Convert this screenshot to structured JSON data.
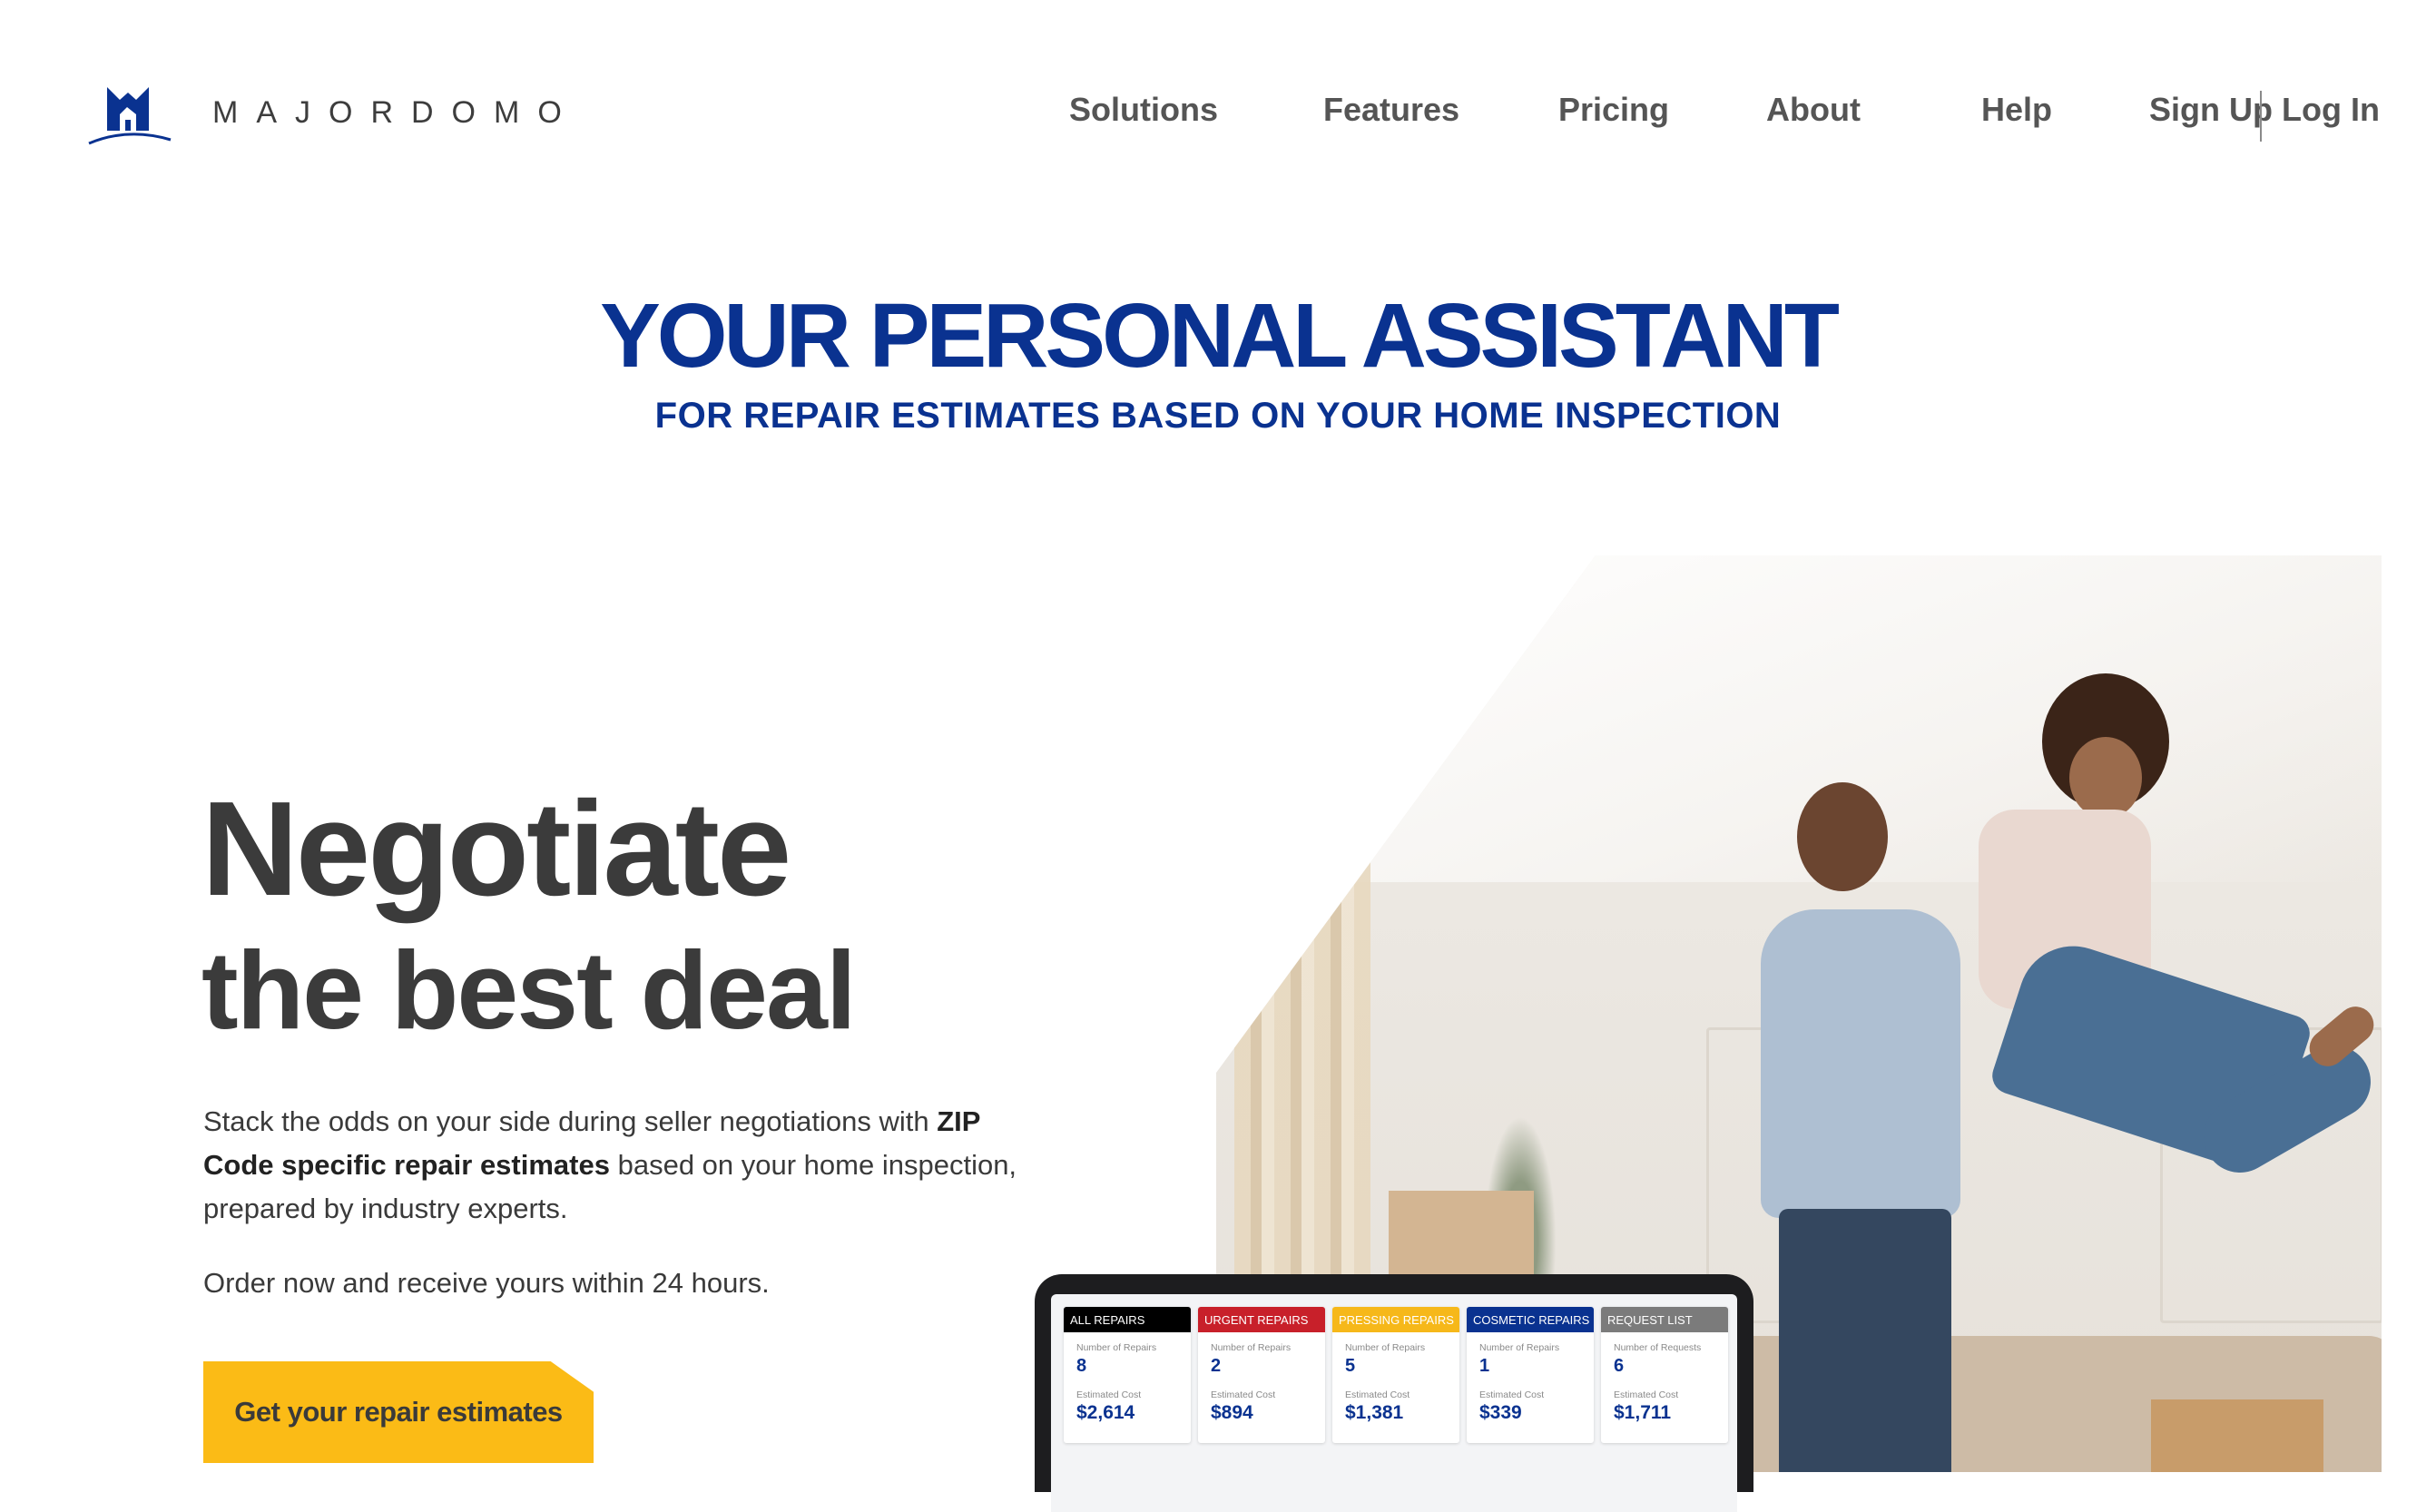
{
  "brand": {
    "name": "MAJORDOMO",
    "color": "#0a3290",
    "logo_icon": "house-logo-icon"
  },
  "nav": {
    "items": [
      "Solutions",
      "Features",
      "Pricing",
      "About",
      "Help",
      "Sign Up",
      "Log In"
    ]
  },
  "hero": {
    "title": "YOUR PERSONAL ASSISTANT",
    "subtitle": "FOR REPAIR ESTIMATES BASED ON YOUR HOME INSPECTION"
  },
  "main": {
    "headline_1": "Negotiate",
    "headline_2": "the best deal",
    "p1_a": "Stack the odds on your side during seller negotiations with ",
    "p1_bold": "ZIP Code specific repair estimates",
    "p1_c": " based on your home inspection, prepared by industry experts.",
    "p2": "Order now and receive yours within 24 hours.",
    "cta_label": "Get your repair estimates",
    "cta_color": "#fbbb16"
  },
  "photo": {
    "alt": "couple-celebrating-photo"
  },
  "dashboard": {
    "cards": [
      {
        "title": "ALL REPAIRS",
        "color": "#000000",
        "count_label": "Number of Repairs",
        "count": "8",
        "cost_label": "Estimated Cost",
        "cost": "$2,614"
      },
      {
        "title": "URGENT REPAIRS",
        "color": "#c8202a",
        "count_label": "Number of Repairs",
        "count": "2",
        "cost_label": "Estimated Cost",
        "cost": "$894"
      },
      {
        "title": "PRESSING REPAIRS",
        "color": "#f6b81a",
        "count_label": "Number of Repairs",
        "count": "5",
        "cost_label": "Estimated Cost",
        "cost": "$1,381"
      },
      {
        "title": "COSMETIC REPAIRS",
        "color": "#0a3290",
        "count_label": "Number of Repairs",
        "count": "1",
        "cost_label": "Estimated Cost",
        "cost": "$339"
      },
      {
        "title": "REQUEST LIST",
        "color": "#7b7b7b",
        "count_label": "Number of Requests",
        "count": "6",
        "cost_label": "Estimated Cost",
        "cost": "$1,711"
      }
    ]
  }
}
